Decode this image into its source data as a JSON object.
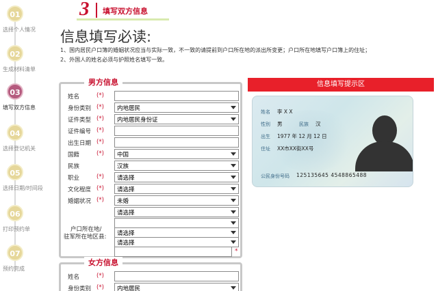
{
  "steps": [
    {
      "num": "01",
      "label": "选择个人情况"
    },
    {
      "num": "02",
      "label": "生成材料清单"
    },
    {
      "num": "03",
      "label": "填写双方信息"
    },
    {
      "num": "04",
      "label": "选择登记机关"
    },
    {
      "num": "05",
      "label": "选择日期/时间段"
    },
    {
      "num": "06",
      "label": "打印预约单"
    },
    {
      "num": "07",
      "label": "预约完成"
    }
  ],
  "banner": {
    "num": "3",
    "text": "填写双方信息"
  },
  "notice": {
    "title": "信息填写必读:",
    "line1": "1、国内居民户口簿的婚姻状况应当与实际一致，不一致的请提前到户口所在地的派出所变更；户口所在地填写户口簿上的住址；",
    "line2": "2、外国人的姓名必须与护照姓名填写一致。"
  },
  "male": {
    "legend": "男方信息",
    "required_mark": "(*)",
    "fields": {
      "name": {
        "label": "姓名",
        "value": ""
      },
      "identity_type": {
        "label": "身份类别",
        "value": "内地居民"
      },
      "doc_type": {
        "label": "证件类型",
        "value": "内地居民身份证"
      },
      "doc_no": {
        "label": "证件编号",
        "value": ""
      },
      "birth": {
        "label": "出生日期",
        "value": ""
      },
      "nationality": {
        "label": "国籍",
        "value": "中国"
      },
      "ethnicity": {
        "label": "民族",
        "value": "汉族"
      },
      "occupation": {
        "label": "职业",
        "value": "请选择"
      },
      "education": {
        "label": "文化程度",
        "value": "请选择"
      },
      "marital": {
        "label": "婚姻状况",
        "value": "未婚"
      }
    },
    "hukou": {
      "label1": "户口所在地/",
      "label2": "驻军所在地区县:",
      "select1": "请选择",
      "select2": "",
      "select3": "请选择",
      "select4": "请选择",
      "address": "",
      "address_mark": "*"
    }
  },
  "female": {
    "legend": "女方信息",
    "fields": {
      "name": {
        "label": "姓名",
        "value": ""
      },
      "identity_type": {
        "label": "身份类别",
        "value": "内地居民"
      }
    }
  },
  "hint": {
    "title": "信息填写提示区",
    "card": {
      "name_label": "姓名",
      "name_value": "李 X X",
      "sex_label": "性别",
      "sex_value": "男",
      "ethnic_label": "民族",
      "ethnic_value": "汉",
      "birth_label": "出生",
      "birth_value": "1977 年 12 月 12 日",
      "addr_label": "住址",
      "addr_value": "XX市XX街XX号",
      "id_label": "公民身份号码",
      "id_value": "125135645 4548865488"
    }
  }
}
